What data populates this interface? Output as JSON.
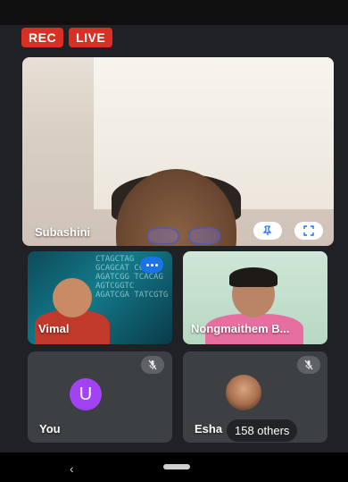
{
  "badges": {
    "rec": "REC",
    "live": "LIVE"
  },
  "colors": {
    "badge_red": "#d93025",
    "more_blue": "#1a73e8",
    "avatar_purple": "#a142f4"
  },
  "participants": {
    "main": {
      "name": "Subashini"
    },
    "vimal": {
      "name": "Vimal",
      "dna_text": "CTAGCTAG GCAGCAT CCAGT AGATCGG TCACAG AGTCGGTC AGATCGA TATCGTG"
    },
    "nong": {
      "name": "Nongmaithem B..."
    },
    "you": {
      "name": "You",
      "initial": "U"
    },
    "esha": {
      "name": "Esha",
      "others": "158 others"
    }
  },
  "nav": {
    "back_icon": "‹"
  },
  "icons": [
    "pin-icon",
    "fullscreen-icon",
    "more-dots-icon",
    "mic-off-icon",
    "back-icon",
    "home-pill-icon"
  ]
}
